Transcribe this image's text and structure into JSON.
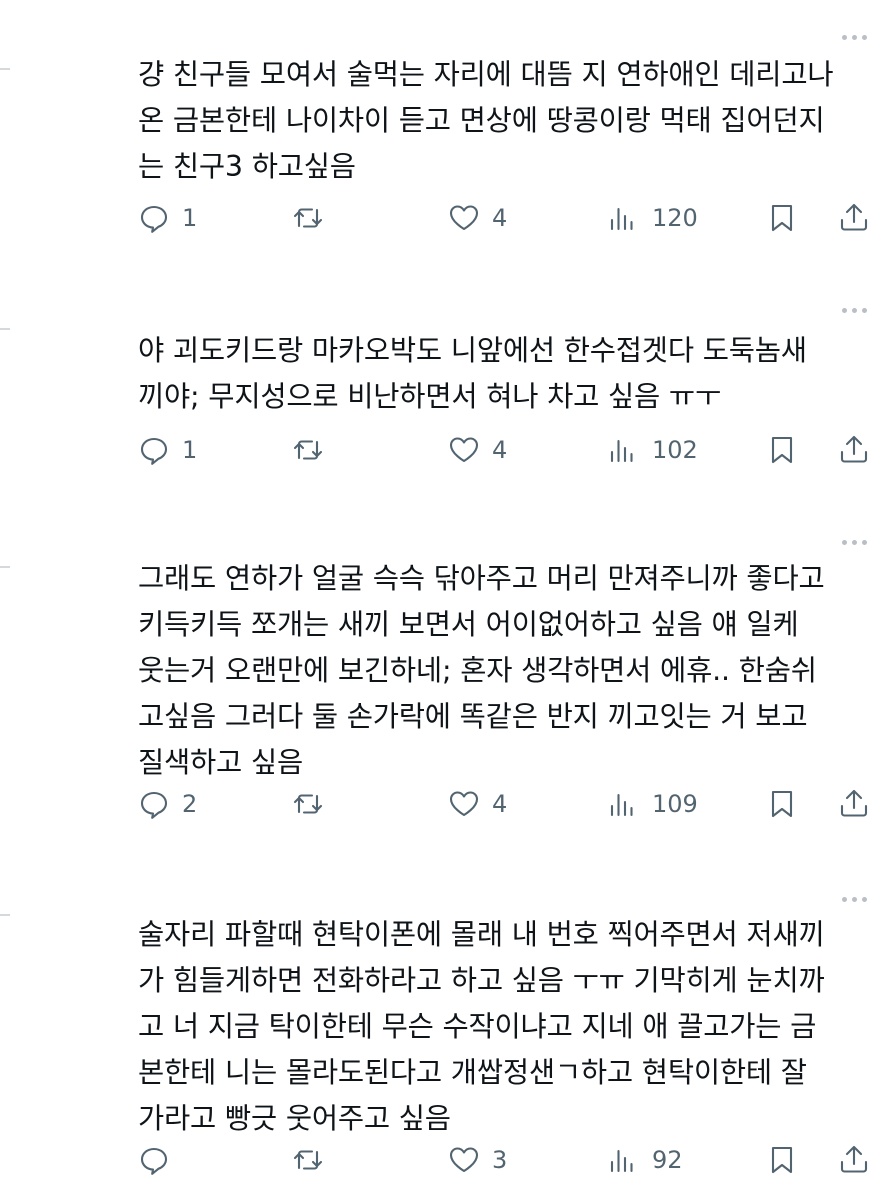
{
  "posts": [
    {
      "text": "걍 친구들 모여서 술먹는 자리에 대뜸 지 연하애인 데리고나\n온 금본한테 나이차이 듣고 면상에 땅콩이랑 먹태 집어던지\n는 친구3 하고싶음",
      "replies": "1",
      "reposts": "",
      "likes": "4",
      "views": "120"
    },
    {
      "text": "야 괴도키드랑 마카오박도 니앞에선 한수접겟다 도둑놈새\n끼야; 무지성으로 비난하면서 혀나 차고 싶음 ㅠㅜ",
      "replies": "1",
      "reposts": "",
      "likes": "4",
      "views": "102"
    },
    {
      "text": "그래도 연하가 얼굴 슥슥 닦아주고 머리 만져주니까 좋다고\n키득키득 쪼개는 새끼 보면서 어이없어하고 싶음 얘 일케\n웃는거 오랜만에 보긴하네; 혼자 생각하면서 에휴.. 한숨쉬\n고싶음 그러다 둘 손가락에 똑같은 반지 끼고잇는 거 보고\n질색하고 싶음",
      "replies": "2",
      "reposts": "",
      "likes": "4",
      "views": "109"
    },
    {
      "text": "술자리 파할때 현탁이폰에 몰래 내 번호 찍어주면서 저새끼\n가 힘들게하면 전화하라고 하고 싶음 ㅜㅠ 기막히게 눈치까\n고 너 지금 탁이한테 무슨 수작이냐고 지네 애 끌고가는 금\n본한테 니는 몰라도된다고 개쌉정샌ㄱ하고 현탁이한테 잘\n가라고 빵긋 웃어주고 싶음",
      "replies": "",
      "reposts": "",
      "likes": "3",
      "views": "92"
    }
  ],
  "icons": {
    "reply": "reply-bubble-icon",
    "repost": "repost-arrows-icon",
    "like": "heart-icon",
    "views": "views-bars-icon",
    "bookmark": "bookmark-icon",
    "share": "share-upload-icon",
    "more": "more-dots-icon"
  },
  "colors": {
    "text": "#0f1419",
    "icon": "#536471",
    "dots": "#b9bfc5",
    "background": "#ffffff"
  }
}
